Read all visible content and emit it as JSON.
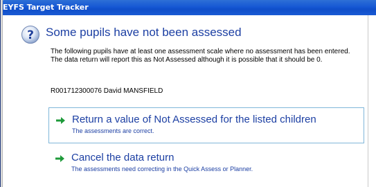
{
  "window": {
    "title": "EYFS Target Tracker"
  },
  "dialog": {
    "icon": "question-icon",
    "heading": "Some pupils have not been assessed",
    "message": "The following pupils have at least one assessment scale where no assessment has been entered. The data return will report this as Not Assessed although it is possible that it should be 0.",
    "pupils": [
      "R001712300076 David MANSFIELD"
    ]
  },
  "options": [
    {
      "icon": "green-arrow-icon",
      "title": "Return a value of Not Assessed for the listed children",
      "subtitle": "The assessments are correct."
    },
    {
      "icon": "green-arrow-icon",
      "title": "Cancel the data return",
      "subtitle": "The assessments need correcting in the Quick Assess or Planner."
    }
  ],
  "colors": {
    "titlebar": "#1658d4",
    "link_text": "#1c3fa3",
    "arrow": "#1e9a3a",
    "option_border": "#7fb6d9"
  }
}
